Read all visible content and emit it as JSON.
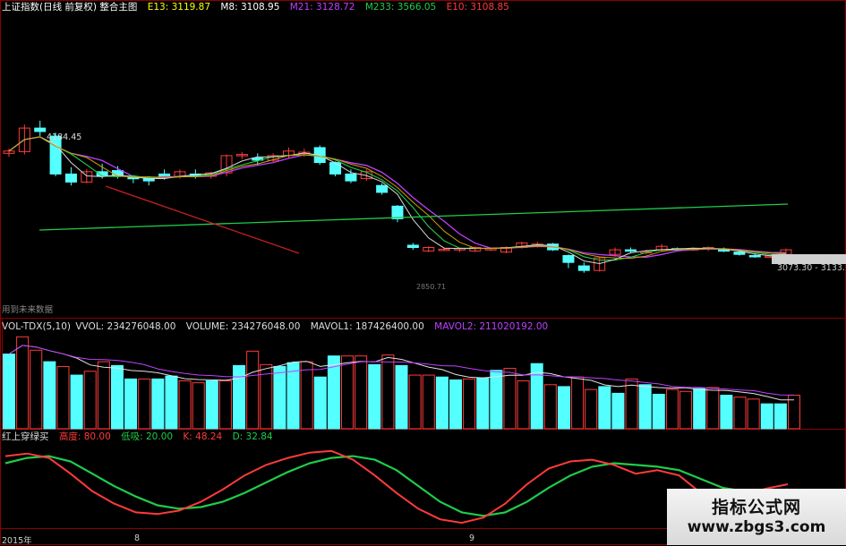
{
  "main_header": {
    "title": "上证指数(日线 前复权) 整合主图",
    "e13": "E13: 3119.87",
    "m8": "M8: 3108.95",
    "m21": "M21: 3128.72",
    "m233": "M233: 3566.05",
    "e10": "E10: 3108.85"
  },
  "colors": {
    "up": "#ff3b3b",
    "down": "#54ffff",
    "bg": "#000000",
    "grid": "#8a0000",
    "m21": "#c040ff",
    "m233": "#1fcc4a",
    "yellow": "#ffff00"
  },
  "annotations": {
    "high": "4184.45",
    "current": "3073.30 - 3133.1",
    "low_hint": "2850.71",
    "future": "用到未来数据"
  },
  "volume_header": {
    "label": "VOL-TDX(5,10)",
    "vvol": "VVOL: 234276048.00",
    "volume": "VOLUME: 234276048.00",
    "mavol1": "MAVOL1: 187426400.00",
    "mavol2": "MAVOL2: 211020192.00"
  },
  "kd_header": {
    "label": "红上穿绿买",
    "high": "高度: 80.00",
    "low": "低吸: 20.00",
    "k": "K: 48.24",
    "d": "D: 32.84"
  },
  "time_axis": {
    "year": "2015年",
    "m8": "8",
    "m9": "9"
  },
  "watermark": {
    "title": "指标公式网",
    "url": "www.zbgs3.com"
  },
  "chart_data": [
    {
      "type": "candlestick",
      "title": "上证指数(日线 前复权)",
      "candles": [
        [
          3900,
          3940,
          3870,
          3920
        ],
        [
          3915,
          4150,
          3890,
          4120
        ],
        [
          4120,
          4184,
          4050,
          4090
        ],
        [
          4050,
          4080,
          3700,
          3720
        ],
        [
          3720,
          3780,
          3620,
          3650
        ],
        [
          3650,
          3760,
          3640,
          3740
        ],
        [
          3740,
          3810,
          3680,
          3700
        ],
        [
          3750,
          3790,
          3680,
          3700
        ],
        [
          3690,
          3710,
          3640,
          3680
        ],
        [
          3680,
          3700,
          3620,
          3660
        ],
        [
          3720,
          3760,
          3670,
          3700
        ],
        [
          3700,
          3760,
          3680,
          3740
        ],
        [
          3720,
          3760,
          3680,
          3700
        ],
        [
          3700,
          3740,
          3680,
          3730
        ],
        [
          3730,
          3890,
          3700,
          3880
        ],
        [
          3880,
          3910,
          3850,
          3890
        ],
        [
          3860,
          3900,
          3800,
          3840
        ],
        [
          3840,
          3900,
          3820,
          3880
        ],
        [
          3880,
          3950,
          3860,
          3920
        ],
        [
          3900,
          3940,
          3870,
          3910
        ],
        [
          3950,
          3970,
          3800,
          3820
        ],
        [
          3820,
          3830,
          3700,
          3720
        ],
        [
          3720,
          3760,
          3640,
          3660
        ],
        [
          3680,
          3760,
          3660,
          3740
        ],
        [
          3620,
          3640,
          3540,
          3560
        ],
        [
          3440,
          3450,
          3300,
          3330
        ],
        [
          3100,
          3120,
          3060,
          3080
        ],
        [
          3050,
          3090,
          3040,
          3080
        ],
        [
          3060,
          3080,
          3050,
          3065
        ],
        [
          3060,
          3080,
          3040,
          3070
        ],
        [
          3050,
          3090,
          3040,
          3080
        ],
        [
          3060,
          3080,
          3050,
          3070
        ],
        [
          3040,
          3090,
          3030,
          3080
        ],
        [
          3080,
          3130,
          3070,
          3120
        ],
        [
          3100,
          3130,
          3080,
          3110
        ],
        [
          3110,
          3120,
          3050,
          3060
        ],
        [
          3010,
          3020,
          2900,
          2950
        ],
        [
          2920,
          2950,
          2860,
          2880
        ],
        [
          2880,
          3000,
          2870,
          2990
        ],
        [
          3020,
          3080,
          3000,
          3060
        ],
        [
          3060,
          3080,
          3030,
          3050
        ],
        [
          3040,
          3060,
          3020,
          3045
        ],
        [
          3060,
          3110,
          3040,
          3090
        ],
        [
          3070,
          3080,
          3050,
          3065
        ],
        [
          3060,
          3080,
          3050,
          3070
        ],
        [
          3070,
          3090,
          3050,
          3080
        ],
        [
          3060,
          3080,
          3040,
          3050
        ],
        [
          3040,
          3060,
          3010,
          3020
        ],
        [
          3010,
          3030,
          2990,
          3000
        ],
        [
          3000,
          3020,
          2990,
          3005
        ],
        [
          3020,
          3070,
          3010,
          3060
        ]
      ],
      "series": [
        {
          "name": "M21"
        },
        {
          "name": "M233"
        },
        {
          "name": "E13"
        },
        {
          "name": "E10"
        }
      ]
    },
    {
      "type": "bar",
      "title": "VOL-TDX(5,10)",
      "values": [
        78,
        96,
        82,
        70,
        65,
        56,
        60,
        70,
        66,
        52,
        52,
        52,
        55,
        50,
        48,
        50,
        50,
        66,
        81,
        67,
        65,
        69,
        70,
        54,
        76,
        76,
        76,
        67,
        77,
        66,
        56,
        56,
        54,
        51,
        52,
        53,
        61,
        63,
        50,
        68,
        46,
        44,
        54,
        41,
        44,
        37,
        52,
        46,
        36,
        41,
        39,
        42,
        43,
        35,
        33,
        31,
        26,
        26,
        35
      ],
      "series": [
        {
          "name": "MAVOL1"
        },
        {
          "name": "MAVOL2"
        }
      ]
    },
    {
      "type": "line",
      "title": "红上穿绿买",
      "ylim": [
        0,
        100
      ],
      "series": [
        {
          "name": "K"
        },
        {
          "name": "D"
        }
      ]
    }
  ]
}
